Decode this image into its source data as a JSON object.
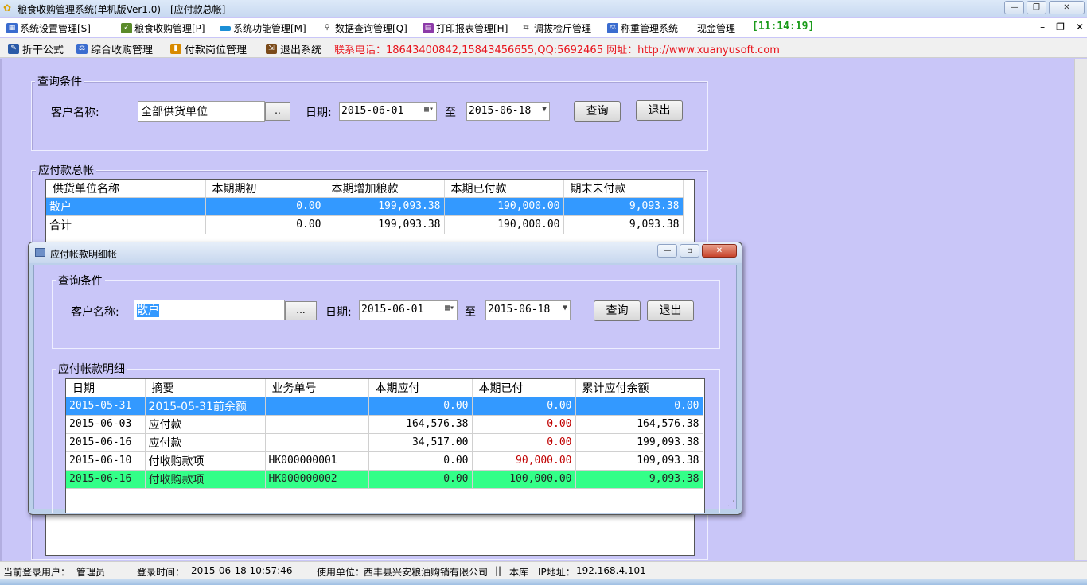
{
  "window": {
    "title": "粮食收购管理系统(单机版Ver1.0) - [应付款总帐]"
  },
  "menu": {
    "items": [
      {
        "label": "系统设置管理[S]"
      },
      {
        "label": "粮食收购管理[P]"
      },
      {
        "label": "系统功能管理[M]"
      },
      {
        "label": "数据查询管理[Q]"
      },
      {
        "label": "打印报表管理[H]"
      },
      {
        "label": "调拔检斤管理"
      },
      {
        "label": "称重管理系统"
      },
      {
        "label": "现金管理"
      }
    ],
    "clock": "[11:14:19]"
  },
  "toolbar": {
    "items": [
      {
        "label": "折干公式"
      },
      {
        "label": "综合收购管理"
      },
      {
        "label": "付款岗位管理"
      },
      {
        "label": "退出系统"
      }
    ],
    "contact": "联系电话：18643400842,15843456655,QQ:5692465 网址：http://www.xuanyusoft.com"
  },
  "main": {
    "query_title": "查询条件",
    "customer_label": "客户名称:",
    "customer_value": "全部供货单位",
    "browse_label": "..",
    "date_label": "日期:",
    "date_from": "2015-06-01",
    "to_label": "至",
    "date_to": "2015-06-18",
    "query_button": "查询",
    "exit_button": "退出",
    "ledger_title": "应付款总帐",
    "columns": [
      "供货单位名称",
      "本期期初",
      "本期增加粮款",
      "本期已付款",
      "期末未付款"
    ],
    "rows": [
      [
        "散户",
        "0.00",
        "199,093.38",
        "190,000.00",
        "9,093.38"
      ],
      [
        "合计",
        "0.00",
        "199,093.38",
        "190,000.00",
        "9,093.38"
      ]
    ]
  },
  "dialog": {
    "title": "应付帐款明细帐",
    "query_title": "查询条件",
    "customer_label": "客户名称:",
    "customer_value": "散户",
    "browse_label": "...",
    "date_label": "日期:",
    "date_from": "2015-06-01",
    "to_label": "至",
    "date_to": "2015-06-18",
    "query_button": "查询",
    "exit_button": "退出",
    "detail_title": "应付帐款明细",
    "columns": [
      "日期",
      "摘要",
      "业务单号",
      "本期应付",
      "本期已付",
      "累计应付余额"
    ],
    "rows": [
      [
        "2015-05-31",
        "2015-05-31前余额",
        "",
        "0.00",
        "0.00",
        "0.00"
      ],
      [
        "2015-06-03",
        "应付款",
        "",
        "164,576.38",
        "0.00",
        "164,576.38"
      ],
      [
        "2015-06-16",
        "应付款",
        "",
        "34,517.00",
        "0.00",
        "199,093.38"
      ],
      [
        "2015-06-10",
        "付收购款项",
        "HK000000001",
        "0.00",
        "90,000.00",
        "109,093.38"
      ],
      [
        "2015-06-16",
        "付收购款项",
        "HK000000002",
        "0.00",
        "100,000.00",
        "9,093.38"
      ]
    ]
  },
  "status": {
    "user_label": "当前登录用户：",
    "user": "管理员",
    "login_label": "登录时间：",
    "login_time": "2015-06-18 10:57:46",
    "unit_label": "使用单位：",
    "unit": "西丰县兴安粮油购销有限公司",
    "sep": "||",
    "db": "本库",
    "ip_label": "IP地址：",
    "ip": "192.168.4.101"
  },
  "colors": {
    "selected_row": "#3399ff",
    "paid_row": "#33ff88",
    "background": "#c9c6f8",
    "contact": "#e8141c",
    "clock": "#1a9a1a"
  }
}
